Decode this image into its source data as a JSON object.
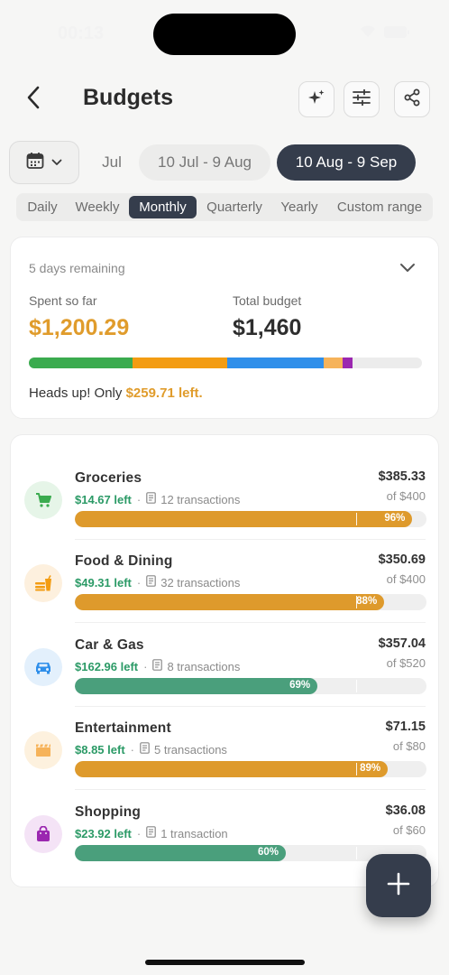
{
  "status_bar": {
    "time": "00:13"
  },
  "header": {
    "title": "Budgets"
  },
  "periods": {
    "items": [
      {
        "label": "Jul"
      },
      {
        "label": "10 Jul - 9 Aug"
      },
      {
        "label": "10 Aug - 9 Sep"
      }
    ],
    "selected": "10 Aug - 9 Sep"
  },
  "granularity": {
    "items": [
      "Daily",
      "Weekly",
      "Monthly",
      "Quarterly",
      "Yearly",
      "Custom range"
    ],
    "selected": "Monthly"
  },
  "summary": {
    "remaining_text": "5 days remaining",
    "spent_label": "Spent so far",
    "spent_value": "$1,200.29",
    "total_label": "Total budget",
    "total_value": "$1,460",
    "heads_up_prefix": "Heads up! Only ",
    "heads_up_amount": "$259.71 left.",
    "breakdown": [
      {
        "name": "Groceries",
        "fraction": 0.264,
        "color": "#3bab4f"
      },
      {
        "name": "Food & Dining",
        "fraction": 0.24,
        "color": "#f39c12"
      },
      {
        "name": "Car & Gas",
        "fraction": 0.245,
        "color": "#2f8fea"
      },
      {
        "name": "Entertainment",
        "fraction": 0.049,
        "color": "#f6b35a"
      },
      {
        "name": "Shopping",
        "fraction": 0.025,
        "color": "#9b27b0"
      }
    ]
  },
  "categories": [
    {
      "name": "Groceries",
      "left": "$14.67 left",
      "transactions": "12 transactions",
      "amount": "$385.33",
      "of": "of $400",
      "percent_label": "96%",
      "fraction": 0.96,
      "bar_color": "#de9a2c",
      "icon": "cart-icon",
      "icon_color": "#3bab4f",
      "icon_bg": "#e6f5e8"
    },
    {
      "name": "Food & Dining",
      "left": "$49.31 left",
      "transactions": "32 transactions",
      "amount": "$350.69",
      "of": "of $400",
      "percent_label": "88%",
      "fraction": 0.88,
      "bar_color": "#de9a2c",
      "icon": "fastfood-icon",
      "icon_color": "#f39c12",
      "icon_bg": "#fdf0de"
    },
    {
      "name": "Car & Gas",
      "left": "$162.96 left",
      "transactions": "8 transactions",
      "amount": "$357.04",
      "of": "of $520",
      "percent_label": "69%",
      "fraction": 0.69,
      "bar_color": "#4a9f7c",
      "icon": "car-icon",
      "icon_color": "#2f8fea",
      "icon_bg": "#e3f0fc"
    },
    {
      "name": "Entertainment",
      "left": "$8.85 left",
      "transactions": "5 transactions",
      "amount": "$71.15",
      "of": "of $80",
      "percent_label": "89%",
      "fraction": 0.89,
      "bar_color": "#de9a2c",
      "icon": "clapperboard-icon",
      "icon_color": "#f6b35a",
      "icon_bg": "#fdf1de"
    },
    {
      "name": "Shopping",
      "left": "$23.92 left",
      "transactions": "1 transaction",
      "amount": "$36.08",
      "of": "of $60",
      "percent_label": "60%",
      "fraction": 0.6,
      "bar_color": "#4a9f7c",
      "icon": "shopping-bag-icon",
      "icon_color": "#9b27b0",
      "icon_bg": "#f4e3f6"
    }
  ]
}
